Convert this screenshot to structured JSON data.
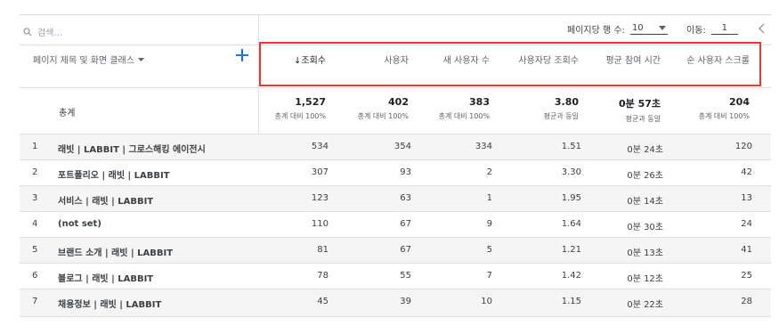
{
  "search": {
    "placeholder": "검색..."
  },
  "pagination": {
    "rows_per_page_label": "페이지당 행 수:",
    "rows_per_page_value": "10",
    "goto_label": "이동:",
    "goto_value": "1"
  },
  "dimension": {
    "label": "페이지 제목 및 화면 클래스"
  },
  "metrics": [
    {
      "label": "조회수",
      "sorted": true
    },
    {
      "label": "사용자"
    },
    {
      "label": "새 사용자 수"
    },
    {
      "label": "사용자당 조회수"
    },
    {
      "label": "평균 참여 시간"
    },
    {
      "label": "순 사용자 스크롤"
    }
  ],
  "totals": {
    "label": "총계",
    "values": [
      "1,527",
      "402",
      "383",
      "3.80",
      "0분 57초",
      "204"
    ],
    "subs": [
      "총계 대비 100%",
      "총계 대비 100%",
      "총계 대비 100%",
      "평균과 동일",
      "평균과 동일",
      "총계 대비 100%"
    ]
  },
  "rows": [
    {
      "idx": "1",
      "title": "래빗 | LABBIT | 그로스해킹 에이전시",
      "values": [
        "534",
        "354",
        "334",
        "1.51",
        "0분 24초",
        "120"
      ]
    },
    {
      "idx": "2",
      "title": "포트폴리오 | 래빗 | LABBIT",
      "values": [
        "307",
        "93",
        "2",
        "3.30",
        "0분 26초",
        "42"
      ]
    },
    {
      "idx": "3",
      "title": "서비스 | 래빗 | LABBIT",
      "values": [
        "123",
        "63",
        "1",
        "1.95",
        "0분 14초",
        "13"
      ]
    },
    {
      "idx": "4",
      "title": "(not set)",
      "values": [
        "110",
        "67",
        "9",
        "1.64",
        "0분 30초",
        "24"
      ]
    },
    {
      "idx": "5",
      "title": "브랜드 소개 | 래빗 | LABBIT",
      "values": [
        "81",
        "67",
        "5",
        "1.21",
        "0분 13초",
        "41"
      ]
    },
    {
      "idx": "6",
      "title": "블로그 | 래빗 | LABBIT",
      "values": [
        "78",
        "55",
        "7",
        "1.42",
        "0분 12초",
        "25"
      ]
    },
    {
      "idx": "7",
      "title": "채용정보 | 래빗 | LABBIT",
      "values": [
        "45",
        "39",
        "10",
        "1.15",
        "0분 22초",
        "28"
      ]
    }
  ],
  "icons": {
    "search": "search-icon",
    "add": "plus-icon",
    "prev": "chevron-left-icon",
    "sort": "arrow-down-icon",
    "dropdown": "caret-down-icon"
  },
  "colors": {
    "accent": "#1a73e8",
    "highlight": "#e53935",
    "row_alt": "#f5f5f5"
  }
}
